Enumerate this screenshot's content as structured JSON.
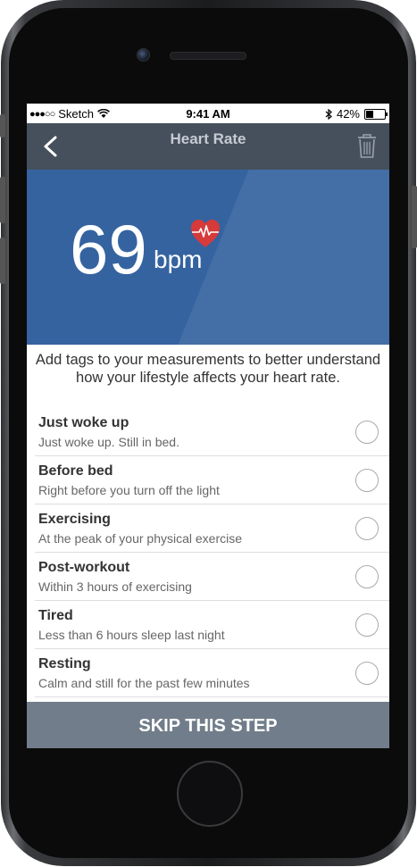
{
  "status": {
    "carrier": "Sketch",
    "time": "9:41 AM",
    "battery": "42%",
    "signal_dots": "●●●○○"
  },
  "nav": {
    "title": "Heart Rate"
  },
  "reading": {
    "value": "69",
    "unit": "bpm"
  },
  "intro": "Add tags to your measurements to better understand how your lifestyle affects your heart rate.",
  "tags": [
    {
      "title": "Just woke up",
      "subtitle": "Just woke up. Still in bed."
    },
    {
      "title": "Before bed",
      "subtitle": "Right before you turn off the light"
    },
    {
      "title": "Exercising",
      "subtitle": "At the peak of your physical exercise"
    },
    {
      "title": "Post-workout",
      "subtitle": "Within 3 hours of exercising"
    },
    {
      "title": "Tired",
      "subtitle": "Less than 6 hours sleep last night"
    },
    {
      "title": "Resting",
      "subtitle": "Calm and still for the past few minutes"
    }
  ],
  "skip_label": "SKIP THIS STEP",
  "colors": {
    "hero": "#3563a0",
    "navbar": "#46505c",
    "skip": "#717d8a",
    "heart": "#d63a3a"
  }
}
